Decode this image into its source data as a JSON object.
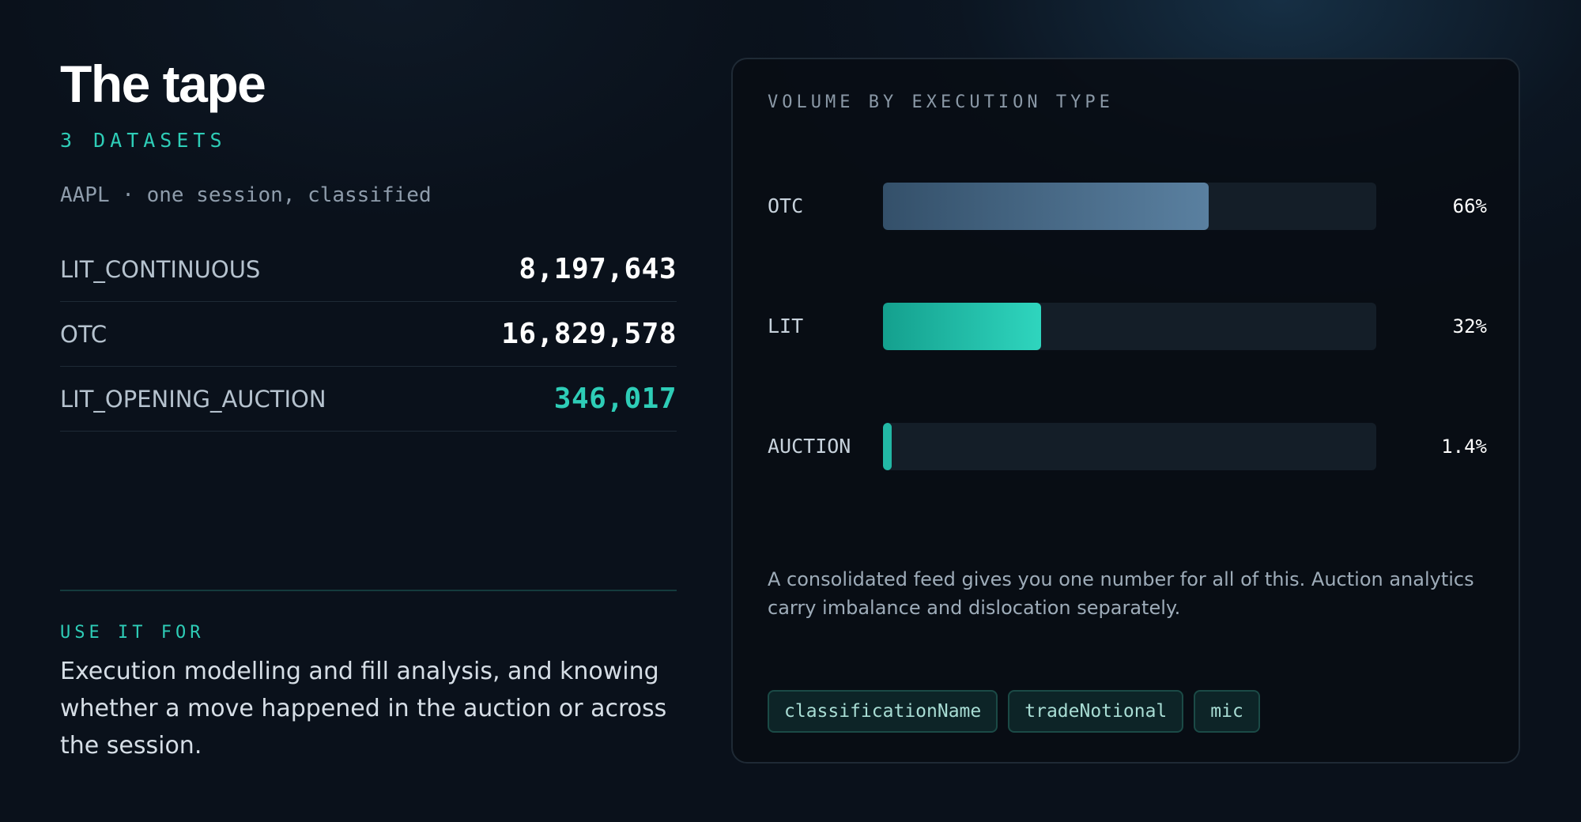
{
  "header": {
    "title": "The tape",
    "subtitle": "3 DATASETS",
    "caption": "AAPL · one session, classified"
  },
  "datasets": [
    {
      "name": "LIT_CONTINUOUS",
      "value": "8,197,643",
      "highlight": false
    },
    {
      "name": "OTC",
      "value": "16,829,578",
      "highlight": false
    },
    {
      "name": "LIT_OPENING_AUCTION",
      "value": "346,017",
      "highlight": true
    }
  ],
  "use": {
    "label": "USE IT FOR",
    "text": "Execution modelling and fill analysis, and knowing whether a move happened in the auction or across the session."
  },
  "card": {
    "title": "VOLUME BY EXECUTION TYPE",
    "note": "A consolidated feed gives you one number for all of this. Auction analytics carry imbalance and dislocation separately.",
    "tags": [
      "classificationName",
      "tradeNotional",
      "mic"
    ]
  },
  "chart_data": {
    "type": "bar",
    "orientation": "horizontal",
    "title": "VOLUME BY EXECUTION TYPE",
    "categories": [
      "OTC",
      "LIT",
      "AUCTION"
    ],
    "values": [
      66,
      32,
      1.4
    ],
    "labels": [
      "66%",
      "32%",
      "1.4%"
    ],
    "unit": "%",
    "xlim": [
      0,
      100
    ],
    "grid": false
  },
  "colors": {
    "accent": "#2ecdb7",
    "background": "#0a111b",
    "otc_bar": "#5a80a0",
    "lit_bar": "#2fd5be"
  }
}
